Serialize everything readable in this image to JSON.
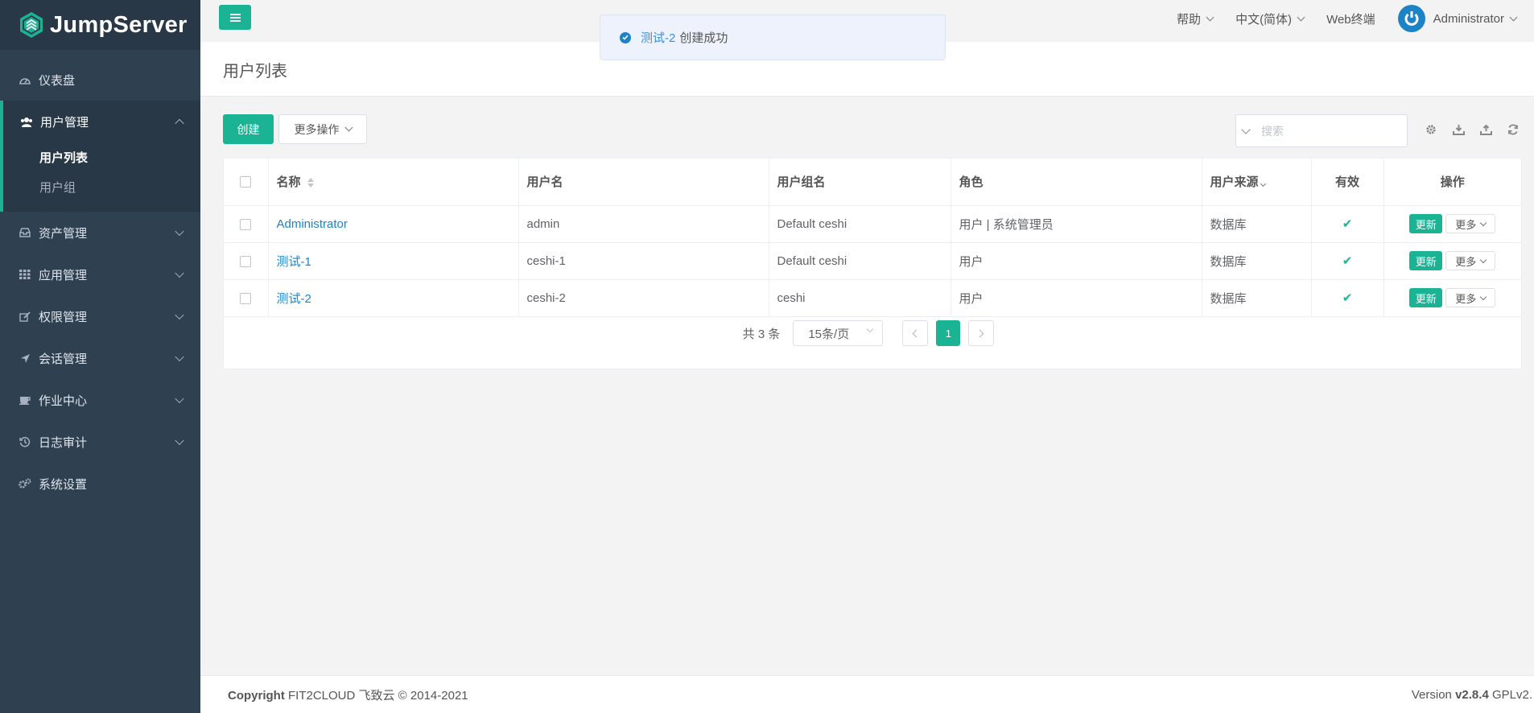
{
  "app": {
    "name": "JumpServer"
  },
  "sidebar": {
    "items": [
      {
        "label": "仪表盘"
      },
      {
        "label": "用户管理"
      },
      {
        "label": "资产管理"
      },
      {
        "label": "应用管理"
      },
      {
        "label": "权限管理"
      },
      {
        "label": "会话管理"
      },
      {
        "label": "作业中心"
      },
      {
        "label": "日志审计"
      },
      {
        "label": "系统设置"
      }
    ],
    "sub_items": [
      {
        "label": "用户列表",
        "active": true
      },
      {
        "label": "用户组",
        "active": false
      }
    ]
  },
  "header": {
    "help": "帮助",
    "language": "中文(简体)",
    "web_terminal": "Web终端",
    "user": "Administrator"
  },
  "toast": {
    "name": "测试-2",
    "message": "创建成功"
  },
  "page": {
    "title": "用户列表"
  },
  "toolbar": {
    "create_label": "创建",
    "more_label": "更多操作",
    "search_placeholder": "搜索"
  },
  "table": {
    "columns": [
      "名称",
      "用户名",
      "用户组名",
      "角色",
      "用户来源",
      "有效",
      "操作"
    ],
    "rows": [
      {
        "name": "Administrator",
        "username": "admin",
        "groups": "Default ceshi",
        "role": "用户 | 系统管理员",
        "source": "数据库",
        "valid": "✔",
        "update": "更新",
        "more": "更多"
      },
      {
        "name": "测试-1",
        "username": "ceshi-1",
        "groups": "Default ceshi",
        "role": "用户",
        "source": "数据库",
        "valid": "✔",
        "update": "更新",
        "more": "更多"
      },
      {
        "name": "测试-2",
        "username": "ceshi-2",
        "groups": "ceshi",
        "role": "用户",
        "source": "数据库",
        "valid": "✔",
        "update": "更新",
        "more": "更多"
      }
    ]
  },
  "pagination": {
    "total": "共 3 条",
    "page_size": "15条/页",
    "current_page": "1"
  },
  "footer": {
    "copyright_label": "Copyright",
    "copyright_text": "FIT2CLOUD 飞致云 © 2014-2021",
    "version_label": "Version",
    "version": "v2.8.4",
    "license": "GPLv2."
  },
  "colors": {
    "accent": "#1ab394",
    "sidebar_bg": "#2f4050",
    "link": "#1c84c6"
  }
}
